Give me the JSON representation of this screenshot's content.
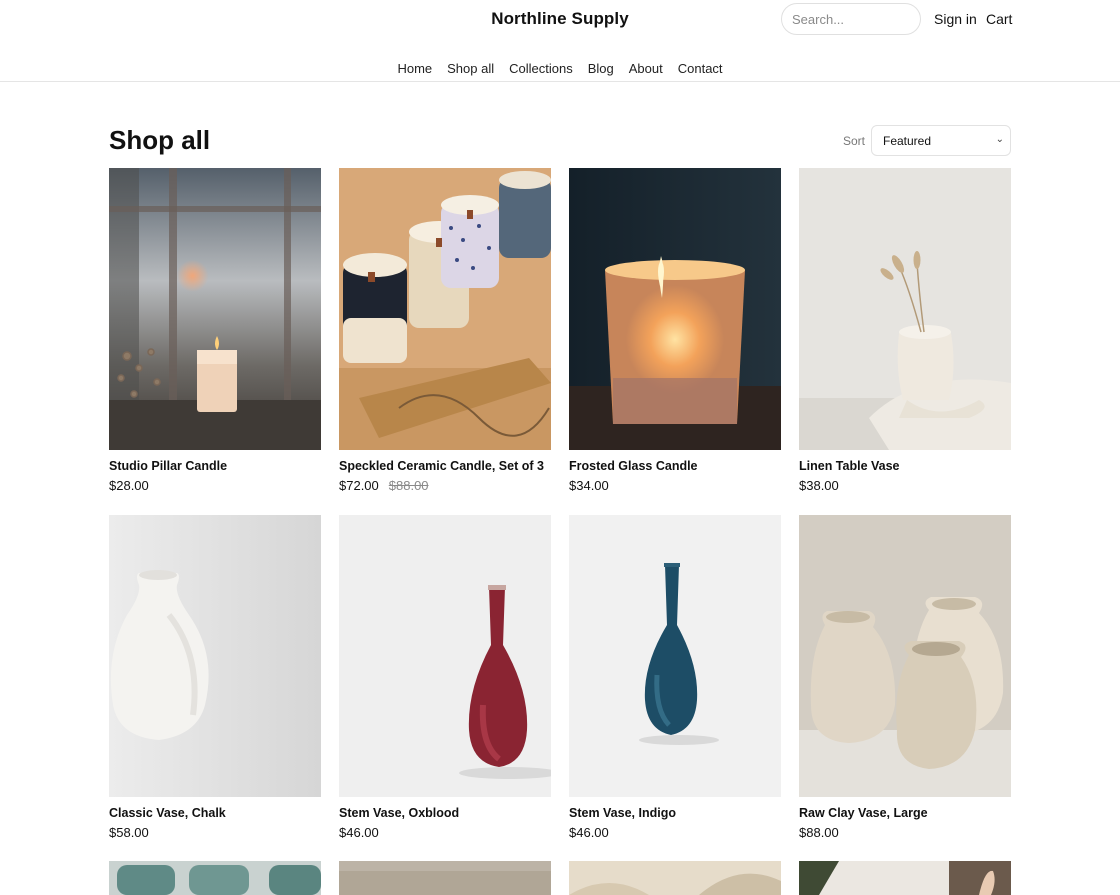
{
  "header": {
    "brand": "Northline Supply",
    "search_placeholder": "Search...",
    "sign_in": "Sign in",
    "cart": "Cart"
  },
  "nav": [
    "Home",
    "Shop all",
    "Collections",
    "Blog",
    "About",
    "Contact"
  ],
  "page": {
    "title": "Shop all",
    "sort_label": "Sort",
    "sort_value": "Featured"
  },
  "products": [
    {
      "name": "Studio Pillar Candle",
      "price": "$28.00",
      "compare_at": ""
    },
    {
      "name": "Speckled Ceramic Candle, Set of 3",
      "price": "$72.00",
      "compare_at": "$88.00"
    },
    {
      "name": "Frosted Glass Candle",
      "price": "$34.00",
      "compare_at": ""
    },
    {
      "name": "Linen Table Vase",
      "price": "$38.00",
      "compare_at": ""
    },
    {
      "name": "Classic Vase, Chalk",
      "price": "$58.00",
      "compare_at": ""
    },
    {
      "name": "Stem Vase, Oxblood",
      "price": "$46.00",
      "compare_at": ""
    },
    {
      "name": "Stem Vase, Indigo",
      "price": "$46.00",
      "compare_at": ""
    },
    {
      "name": "Raw Clay Vase, Large",
      "price": "$88.00",
      "compare_at": ""
    }
  ]
}
